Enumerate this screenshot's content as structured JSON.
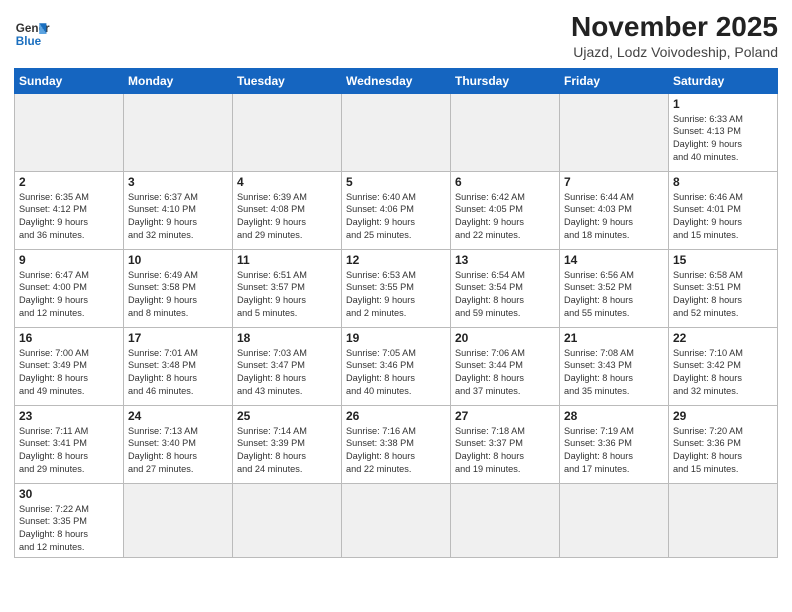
{
  "logo": {
    "general": "General",
    "blue": "Blue"
  },
  "title": "November 2025",
  "subtitle": "Ujazd, Lodz Voivodeship, Poland",
  "weekdays": [
    "Sunday",
    "Monday",
    "Tuesday",
    "Wednesday",
    "Thursday",
    "Friday",
    "Saturday"
  ],
  "weeks": [
    [
      {
        "day": "",
        "info": "",
        "empty": true
      },
      {
        "day": "",
        "info": "",
        "empty": true
      },
      {
        "day": "",
        "info": "",
        "empty": true
      },
      {
        "day": "",
        "info": "",
        "empty": true
      },
      {
        "day": "",
        "info": "",
        "empty": true
      },
      {
        "day": "",
        "info": "",
        "empty": true
      },
      {
        "day": "1",
        "info": "Sunrise: 6:33 AM\nSunset: 4:13 PM\nDaylight: 9 hours\nand 40 minutes."
      }
    ],
    [
      {
        "day": "2",
        "info": "Sunrise: 6:35 AM\nSunset: 4:12 PM\nDaylight: 9 hours\nand 36 minutes."
      },
      {
        "day": "3",
        "info": "Sunrise: 6:37 AM\nSunset: 4:10 PM\nDaylight: 9 hours\nand 32 minutes."
      },
      {
        "day": "4",
        "info": "Sunrise: 6:39 AM\nSunset: 4:08 PM\nDaylight: 9 hours\nand 29 minutes."
      },
      {
        "day": "5",
        "info": "Sunrise: 6:40 AM\nSunset: 4:06 PM\nDaylight: 9 hours\nand 25 minutes."
      },
      {
        "day": "6",
        "info": "Sunrise: 6:42 AM\nSunset: 4:05 PM\nDaylight: 9 hours\nand 22 minutes."
      },
      {
        "day": "7",
        "info": "Sunrise: 6:44 AM\nSunset: 4:03 PM\nDaylight: 9 hours\nand 18 minutes."
      },
      {
        "day": "8",
        "info": "Sunrise: 6:46 AM\nSunset: 4:01 PM\nDaylight: 9 hours\nand 15 minutes."
      }
    ],
    [
      {
        "day": "9",
        "info": "Sunrise: 6:47 AM\nSunset: 4:00 PM\nDaylight: 9 hours\nand 12 minutes."
      },
      {
        "day": "10",
        "info": "Sunrise: 6:49 AM\nSunset: 3:58 PM\nDaylight: 9 hours\nand 8 minutes."
      },
      {
        "day": "11",
        "info": "Sunrise: 6:51 AM\nSunset: 3:57 PM\nDaylight: 9 hours\nand 5 minutes."
      },
      {
        "day": "12",
        "info": "Sunrise: 6:53 AM\nSunset: 3:55 PM\nDaylight: 9 hours\nand 2 minutes."
      },
      {
        "day": "13",
        "info": "Sunrise: 6:54 AM\nSunset: 3:54 PM\nDaylight: 8 hours\nand 59 minutes."
      },
      {
        "day": "14",
        "info": "Sunrise: 6:56 AM\nSunset: 3:52 PM\nDaylight: 8 hours\nand 55 minutes."
      },
      {
        "day": "15",
        "info": "Sunrise: 6:58 AM\nSunset: 3:51 PM\nDaylight: 8 hours\nand 52 minutes."
      }
    ],
    [
      {
        "day": "16",
        "info": "Sunrise: 7:00 AM\nSunset: 3:49 PM\nDaylight: 8 hours\nand 49 minutes."
      },
      {
        "day": "17",
        "info": "Sunrise: 7:01 AM\nSunset: 3:48 PM\nDaylight: 8 hours\nand 46 minutes."
      },
      {
        "day": "18",
        "info": "Sunrise: 7:03 AM\nSunset: 3:47 PM\nDaylight: 8 hours\nand 43 minutes."
      },
      {
        "day": "19",
        "info": "Sunrise: 7:05 AM\nSunset: 3:46 PM\nDaylight: 8 hours\nand 40 minutes."
      },
      {
        "day": "20",
        "info": "Sunrise: 7:06 AM\nSunset: 3:44 PM\nDaylight: 8 hours\nand 37 minutes."
      },
      {
        "day": "21",
        "info": "Sunrise: 7:08 AM\nSunset: 3:43 PM\nDaylight: 8 hours\nand 35 minutes."
      },
      {
        "day": "22",
        "info": "Sunrise: 7:10 AM\nSunset: 3:42 PM\nDaylight: 8 hours\nand 32 minutes."
      }
    ],
    [
      {
        "day": "23",
        "info": "Sunrise: 7:11 AM\nSunset: 3:41 PM\nDaylight: 8 hours\nand 29 minutes."
      },
      {
        "day": "24",
        "info": "Sunrise: 7:13 AM\nSunset: 3:40 PM\nDaylight: 8 hours\nand 27 minutes."
      },
      {
        "day": "25",
        "info": "Sunrise: 7:14 AM\nSunset: 3:39 PM\nDaylight: 8 hours\nand 24 minutes."
      },
      {
        "day": "26",
        "info": "Sunrise: 7:16 AM\nSunset: 3:38 PM\nDaylight: 8 hours\nand 22 minutes."
      },
      {
        "day": "27",
        "info": "Sunrise: 7:18 AM\nSunset: 3:37 PM\nDaylight: 8 hours\nand 19 minutes."
      },
      {
        "day": "28",
        "info": "Sunrise: 7:19 AM\nSunset: 3:36 PM\nDaylight: 8 hours\nand 17 minutes."
      },
      {
        "day": "29",
        "info": "Sunrise: 7:20 AM\nSunset: 3:36 PM\nDaylight: 8 hours\nand 15 minutes."
      }
    ],
    [
      {
        "day": "30",
        "info": "Sunrise: 7:22 AM\nSunset: 3:35 PM\nDaylight: 8 hours\nand 12 minutes."
      },
      {
        "day": "",
        "info": "",
        "empty": true
      },
      {
        "day": "",
        "info": "",
        "empty": true
      },
      {
        "day": "",
        "info": "",
        "empty": true
      },
      {
        "day": "",
        "info": "",
        "empty": true
      },
      {
        "day": "",
        "info": "",
        "empty": true
      },
      {
        "day": "",
        "info": "",
        "empty": true
      }
    ]
  ]
}
